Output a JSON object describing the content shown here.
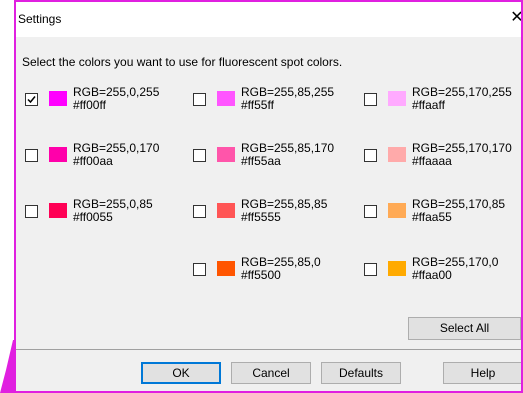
{
  "window": {
    "title": "Settings",
    "close_glyph": "✕",
    "border_color": "#e020e0"
  },
  "instruction": "Select the colors you want to use for fluorescent spot colors.",
  "colors": [
    {
      "rgb": "RGB=255,0,255",
      "hex": "#ff00ff",
      "checked": true
    },
    {
      "rgb": "RGB=255,85,255",
      "hex": "#ff55ff",
      "checked": false
    },
    {
      "rgb": "RGB=255,170,255",
      "hex": "#ffaaff",
      "checked": false
    },
    {
      "rgb": "RGB=255,0,170",
      "hex": "#ff00aa",
      "checked": false
    },
    {
      "rgb": "RGB=255,85,170",
      "hex": "#ff55aa",
      "checked": false
    },
    {
      "rgb": "RGB=255,170,170",
      "hex": "#ffaaaa",
      "checked": false
    },
    {
      "rgb": "RGB=255,0,85",
      "hex": "#ff0055",
      "checked": false
    },
    {
      "rgb": "RGB=255,85,85",
      "hex": "#ff5555",
      "checked": false
    },
    {
      "rgb": "RGB=255,170,85",
      "hex": "#ffaa55",
      "checked": false
    },
    {
      "rgb": "RGB=255,85,0",
      "hex": "#ff5500",
      "checked": false
    },
    {
      "rgb": "RGB=255,170,0",
      "hex": "#ffaa00",
      "checked": false
    }
  ],
  "buttons": {
    "select_all": "Select All",
    "ok": "OK",
    "cancel": "Cancel",
    "defaults": "Defaults",
    "help": "Help"
  }
}
